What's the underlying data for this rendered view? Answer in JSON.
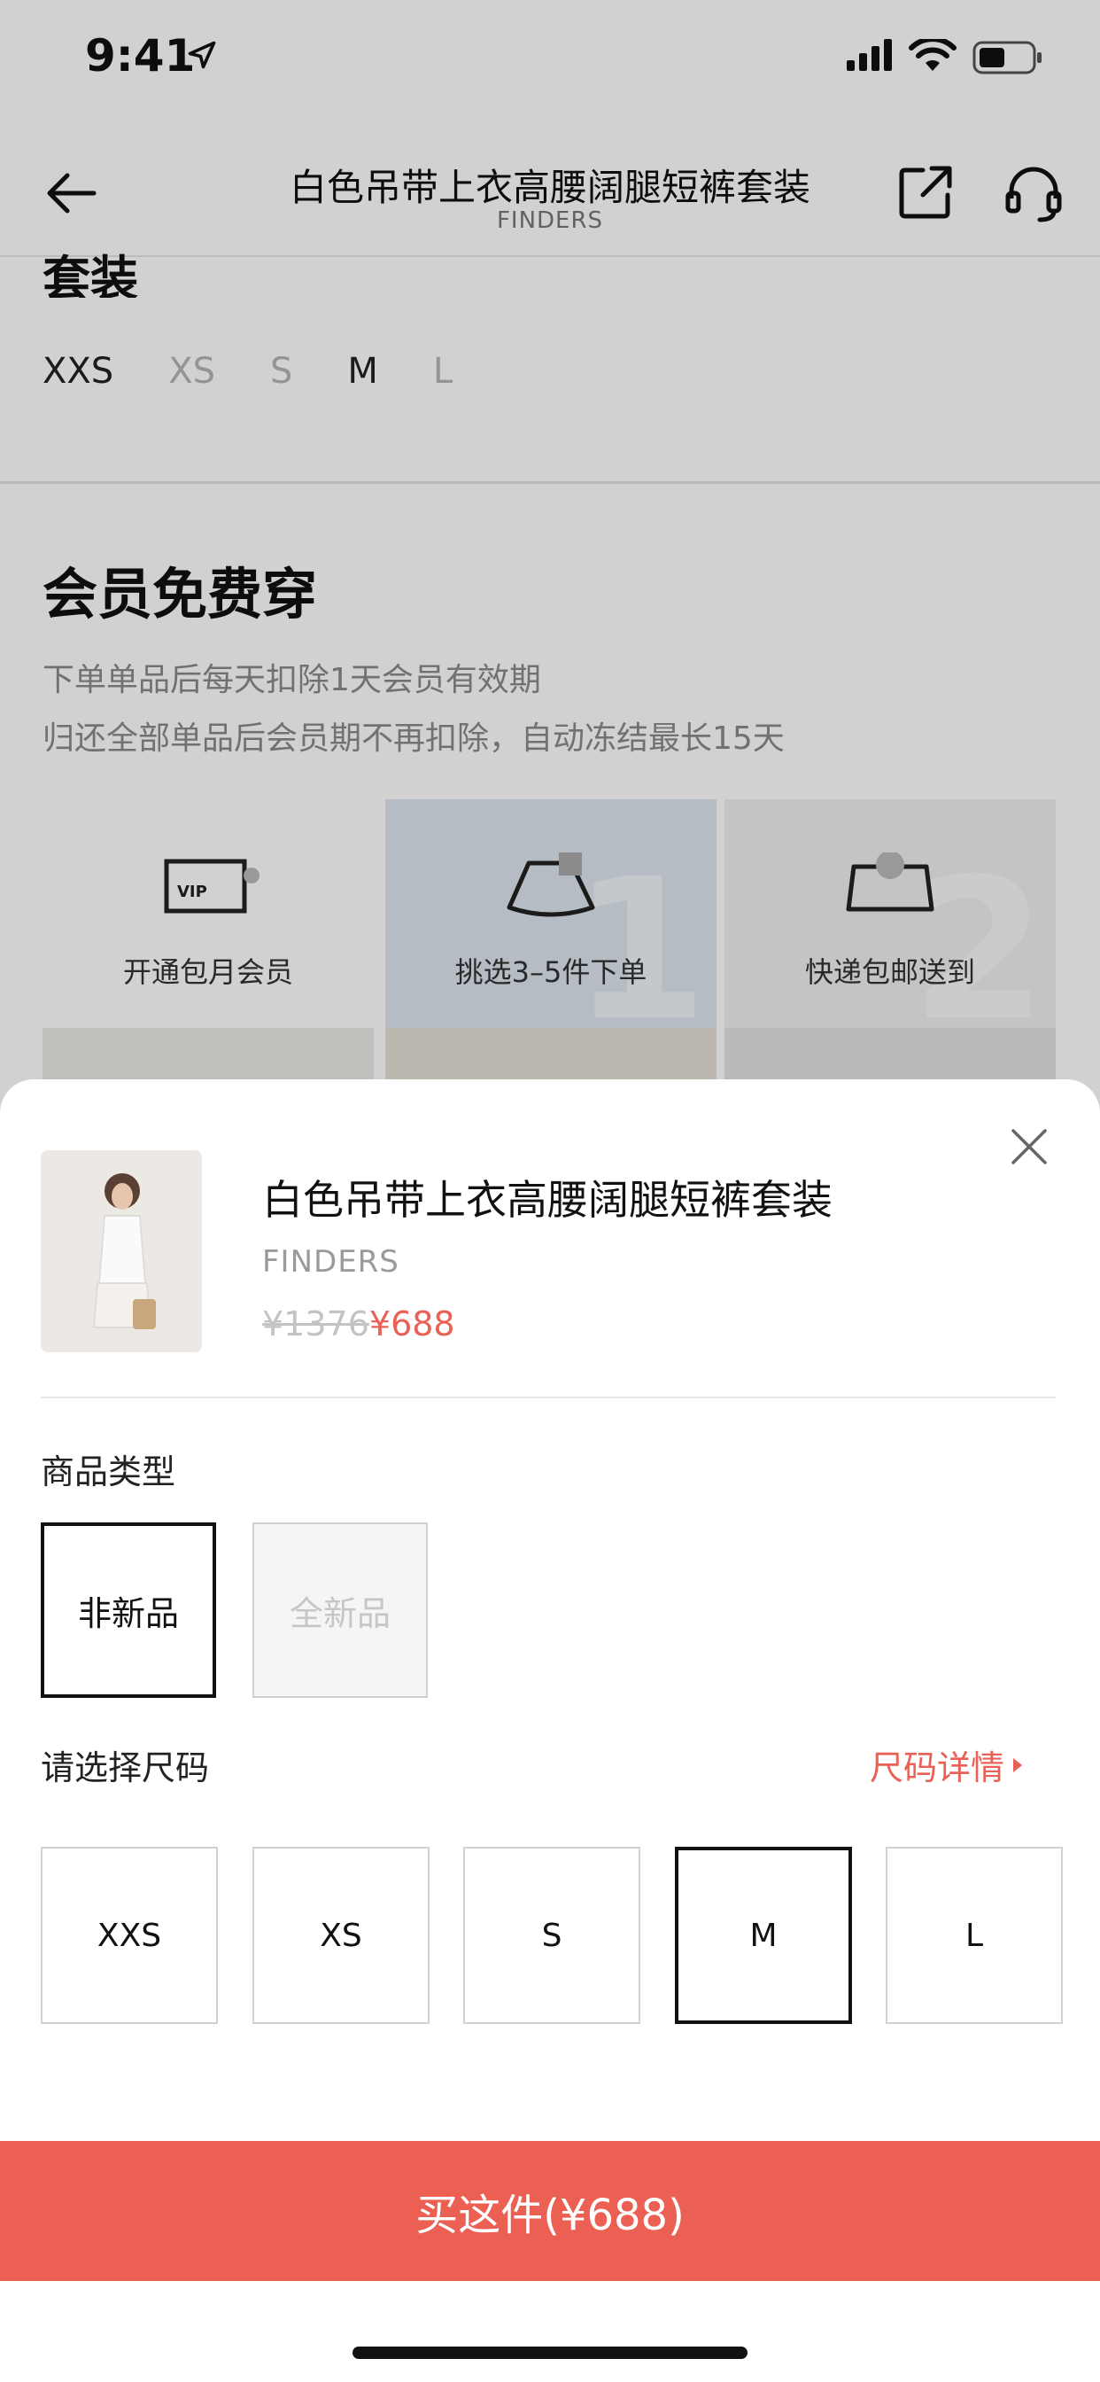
{
  "status_bar": {
    "time": "9:41"
  },
  "nav": {
    "title": "白色吊带上衣高腰阔腿短裤套装",
    "subtitle": "FINDERS"
  },
  "background": {
    "cut_title": "套装",
    "sizes": [
      "XXS",
      "XS",
      "S",
      "M",
      "L"
    ],
    "member": {
      "title": "会员免费穿",
      "desc1": "下单单品后每天扣除1天会员有效期",
      "desc2": "归还全部单品后会员期不再扣除，自动冻结最长15天"
    },
    "steps": [
      {
        "label": "开通包月会员",
        "icon": "vip-card-icon",
        "num": ""
      },
      {
        "label": "挑选3–5件下单",
        "icon": "skirt-icon",
        "num": "1"
      },
      {
        "label": "快递包邮送到",
        "icon": "parcel-icon",
        "num": "2"
      }
    ],
    "vip_text": "VIP"
  },
  "sheet": {
    "product": {
      "name": "白色吊带上衣高腰阔腿短裤套装",
      "brand": "FINDERS",
      "original_price": "¥1376",
      "price": "¥688"
    },
    "type_section": {
      "label": "商品类型",
      "options": [
        {
          "label": "非新品",
          "state": "selected"
        },
        {
          "label": "全新品",
          "state": "disabled"
        }
      ]
    },
    "size_section": {
      "label": "请选择尺码",
      "detail_link": "尺码详情",
      "options": [
        "XXS",
        "XS",
        "S",
        "M",
        "L"
      ],
      "selected": "M"
    },
    "buy_button": "买这件(¥688)"
  },
  "colors": {
    "accent": "#ec5f53",
    "price": "#e96156",
    "text": "#111111",
    "muted": "#9a9a9a"
  }
}
